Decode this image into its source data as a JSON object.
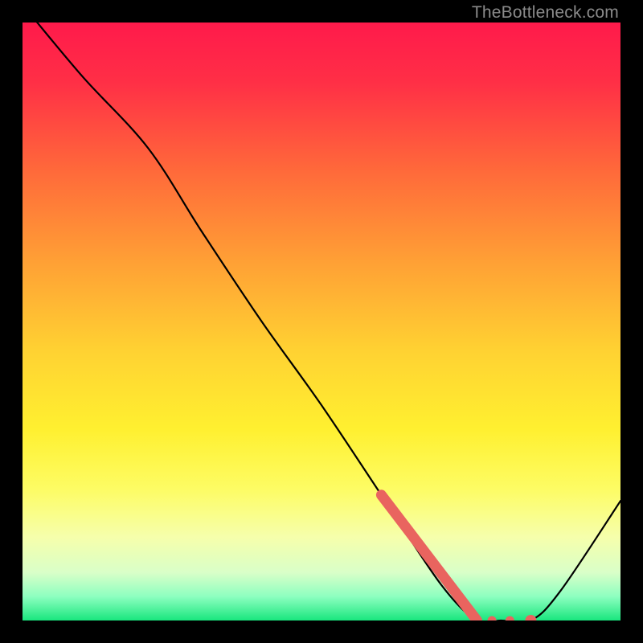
{
  "watermark": "TheBottleneck.com",
  "chart_data": {
    "type": "line",
    "title": "",
    "xlabel": "",
    "ylabel": "",
    "xlim": [
      0,
      100
    ],
    "ylim": [
      0,
      100
    ],
    "grid": false,
    "series": [
      {
        "name": "curve",
        "x": [
          0,
          10,
          21,
          30,
          40,
          50,
          60,
          70,
          76,
          80,
          85,
          90,
          100
        ],
        "y": [
          103,
          91,
          79,
          65,
          50,
          36,
          21,
          6,
          0,
          0,
          0,
          5,
          20
        ]
      }
    ],
    "highlight_segment": {
      "x": [
        60,
        76
      ],
      "y": [
        21,
        0
      ]
    },
    "highlight_dots": {
      "x": [
        78.5,
        81.5,
        85
      ],
      "y": [
        0,
        0,
        0
      ]
    },
    "gradient_stops": [
      {
        "offset": 0.0,
        "color": "#ff1a4b"
      },
      {
        "offset": 0.1,
        "color": "#ff2f46"
      },
      {
        "offset": 0.25,
        "color": "#ff6a3a"
      },
      {
        "offset": 0.4,
        "color": "#ffa035"
      },
      {
        "offset": 0.55,
        "color": "#ffd232"
      },
      {
        "offset": 0.68,
        "color": "#fff030"
      },
      {
        "offset": 0.78,
        "color": "#fdfc64"
      },
      {
        "offset": 0.86,
        "color": "#f6ffab"
      },
      {
        "offset": 0.92,
        "color": "#d9ffc8"
      },
      {
        "offset": 0.96,
        "color": "#8dffc0"
      },
      {
        "offset": 1.0,
        "color": "#19e67e"
      }
    ],
    "accent_color": "#e9645f",
    "curve_color": "#000000"
  }
}
